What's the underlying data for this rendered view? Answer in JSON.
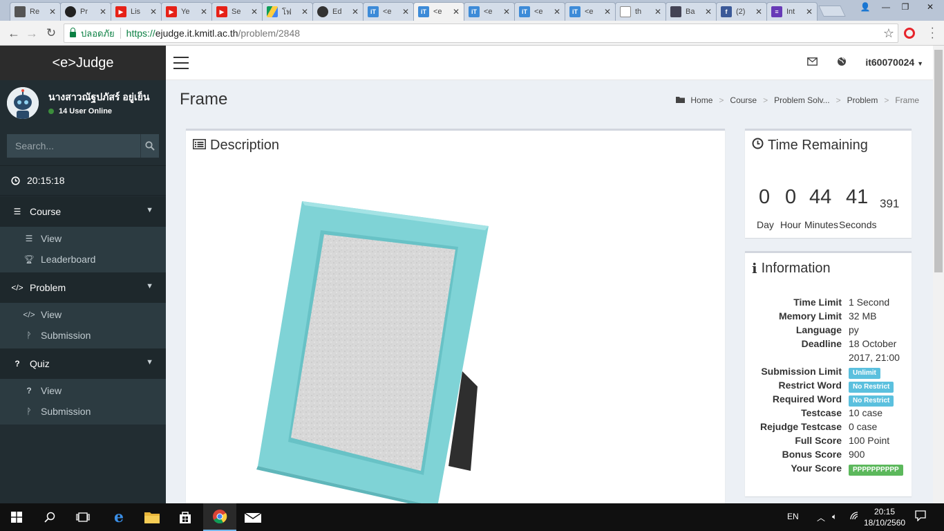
{
  "browser": {
    "tabs": [
      {
        "title": "Re",
        "icon": "generic-page-icon"
      },
      {
        "title": "Pr",
        "icon": "github-icon"
      },
      {
        "title": "Lis",
        "icon": "youtube-icon"
      },
      {
        "title": "Ye",
        "icon": "youtube-icon"
      },
      {
        "title": "Se",
        "icon": "youtube-icon"
      },
      {
        "title": "โฟ",
        "icon": "google-drive-icon"
      },
      {
        "title": "Ed",
        "icon": "avatar-icon"
      },
      {
        "title": "<e",
        "icon": "it-icon"
      },
      {
        "title": "<e",
        "icon": "it-icon"
      },
      {
        "title": "<e",
        "icon": "it-icon"
      },
      {
        "title": "<e",
        "icon": "it-icon"
      },
      {
        "title": "<e",
        "icon": "it-icon"
      },
      {
        "title": "th",
        "icon": "document-icon"
      },
      {
        "title": "Ba",
        "icon": "app-icon"
      },
      {
        "title": "(2)",
        "icon": "facebook-icon"
      },
      {
        "title": "Int",
        "icon": "list-icon"
      }
    ],
    "active_tab": 8,
    "secure_label": "ปลอดภัย",
    "url_scheme": "https://",
    "url_host": "ejudge.it.kmitl.ac.th",
    "url_path": "/problem/2848"
  },
  "sidebar": {
    "logo": "<e>Judge",
    "user_name": "นางสาวณัฐปภัสร์ อยู่เย็น",
    "user_status": "14 User Online",
    "search_placeholder": "Search...",
    "clock": "20:15:18",
    "sections": [
      {
        "label": "Course",
        "icon": "list-icon",
        "items": [
          {
            "label": "View",
            "icon": "list-icon"
          },
          {
            "label": "Leaderboard",
            "icon": "trophy-icon"
          }
        ]
      },
      {
        "label": "Problem",
        "icon": "code-icon",
        "items": [
          {
            "label": "View",
            "icon": "code-icon"
          },
          {
            "label": "Submission",
            "icon": "branch-icon"
          }
        ]
      },
      {
        "label": "Quiz",
        "icon": "question-icon",
        "items": [
          {
            "label": "View",
            "icon": "question-icon"
          },
          {
            "label": "Submission",
            "icon": "branch-icon"
          }
        ]
      }
    ]
  },
  "topbar": {
    "username": "it60070024"
  },
  "page": {
    "title": "Frame",
    "breadcrumb": [
      "Home",
      "Course",
      "Problem Solv...",
      "Problem",
      "Frame"
    ]
  },
  "description": {
    "title": "Description"
  },
  "time_remaining": {
    "title": "Time Remaining",
    "day": "0",
    "hour": "0",
    "minutes": "44",
    "seconds": "41",
    "ms": "391",
    "labels": {
      "day": "Day",
      "hour": "Hour",
      "minutes": "Minutes",
      "seconds": "Seconds"
    }
  },
  "information": {
    "title": "Information",
    "rows": [
      {
        "key": "Time Limit",
        "value": "1 Second"
      },
      {
        "key": "Memory Limit",
        "value": "32 MB"
      },
      {
        "key": "Language",
        "value": "py"
      },
      {
        "key": "Deadline",
        "value": "18 October",
        "value2": "2017, 21:00"
      },
      {
        "key": "Submission Limit",
        "badge": "Unlimit"
      },
      {
        "key": "Restrict Word",
        "badge": "No Restrict"
      },
      {
        "key": "Required Word",
        "badge": "No Restrict"
      },
      {
        "key": "Testcase",
        "value": "10 case"
      },
      {
        "key": "Rejudge Testcase",
        "value": "0 case"
      },
      {
        "key": "Full Score",
        "value": "100 Point"
      },
      {
        "key": "Bonus Score",
        "value": "900"
      },
      {
        "key": "Your Score",
        "badge": "PPPPPPPPPP"
      }
    ]
  },
  "taskbar": {
    "lang": "EN",
    "time": "20:15",
    "date": "18/10/2560"
  },
  "colors": {
    "sidebar_bg": "#222d32",
    "content_bg": "#ecf0f5",
    "label_info": "#5bc0de",
    "label_success": "#5cb85c",
    "frame_teal": "#7fd3d6"
  }
}
